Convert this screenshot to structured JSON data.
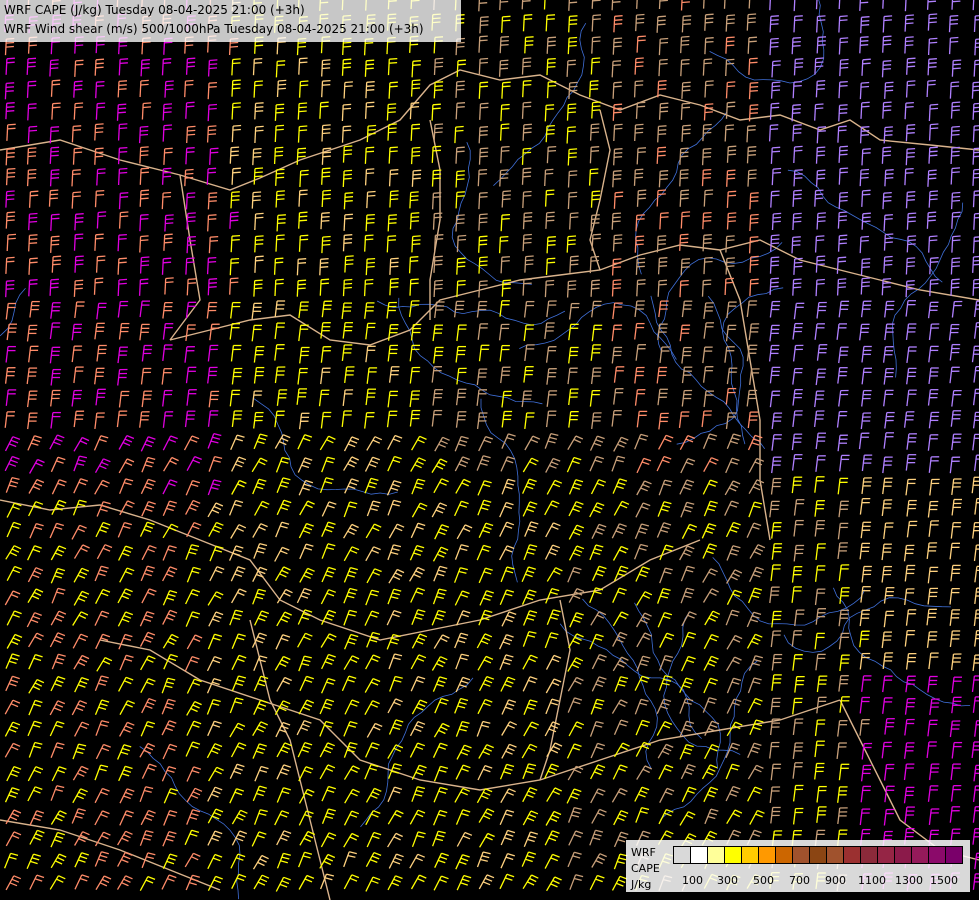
{
  "header": {
    "title_line1": "WRF CAPE (J/kg) Tuesday 08-04-2025 21:00 (+3h)",
    "title_line2": "WRF Wind shear (m/s) 500/1000hPa Tuesday 08-04-2025 21:00 (+3h)"
  },
  "legend": {
    "label_model": "WRF",
    "label_field": "CAPE",
    "label_unit": "J/kg",
    "ticks": [
      "100",
      "300",
      "500",
      "700",
      "900",
      "1100",
      "1300",
      "1500"
    ],
    "colors": [
      "#d9d9d9",
      "#ffffff",
      "#ffff99",
      "#ffff00",
      "#ffcc00",
      "#ff9900",
      "#cc6600",
      "#a0522d",
      "#8b4513",
      "#a0522d",
      "#9b3030",
      "#8b2a3a",
      "#952545",
      "#8b1a4a",
      "#941a5a",
      "#8b0a6a",
      "#7a006a"
    ]
  },
  "map": {
    "background": "#000000",
    "border_color": "#d9b38c",
    "river_color": "#3f6fd8",
    "barb_colors": {
      "shear_low": "#ffff00",
      "shear_mid": "#ffd27f",
      "shear_tan": "#c8a07a",
      "shear_salmon": "#ff8c69",
      "shear_pink": "#ff66cc",
      "shear_magenta": "#e000e0",
      "shear_violet": "#b080ff"
    }
  }
}
